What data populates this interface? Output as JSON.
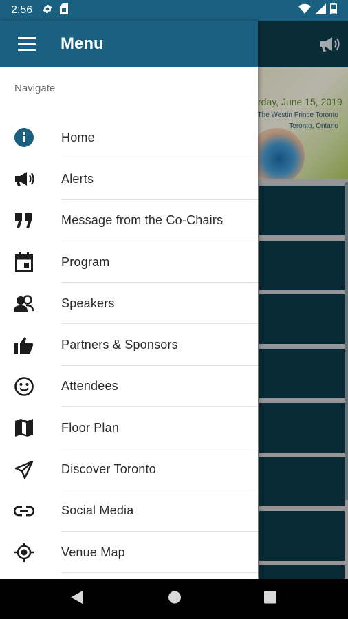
{
  "status_bar": {
    "time": "2:56",
    "icons": [
      "gear-icon",
      "sim-card-icon",
      "wifi-icon",
      "signal-icon",
      "battery-icon"
    ]
  },
  "drawer": {
    "title": "Menu",
    "section_label": "Navigate",
    "items": [
      {
        "label": "Home",
        "icon": "info-icon"
      },
      {
        "label": "Alerts",
        "icon": "megaphone-icon"
      },
      {
        "label": "Message from the Co-Chairs",
        "icon": "quote-icon"
      },
      {
        "label": "Program",
        "icon": "calendar-icon"
      },
      {
        "label": "Speakers",
        "icon": "people-icon"
      },
      {
        "label": "Partners & Sponsors",
        "icon": "thumbs-up-icon"
      },
      {
        "label": "Attendees",
        "icon": "smiley-icon"
      },
      {
        "label": "Floor Plan",
        "icon": "map-icon"
      },
      {
        "label": "Discover Toronto",
        "icon": "paper-plane-icon"
      },
      {
        "label": "Social Media",
        "icon": "link-icon"
      },
      {
        "label": "Venue Map",
        "icon": "location-target-icon"
      }
    ]
  },
  "background": {
    "banner_date": "rday, June 15, 2019",
    "banner_venue": "The Westin Prince Toronto",
    "banner_city": "Toronto, Ontario"
  },
  "colors": {
    "header": "#1a6080",
    "tile": "#0c3b4c",
    "info_icon": "#1a6080"
  }
}
